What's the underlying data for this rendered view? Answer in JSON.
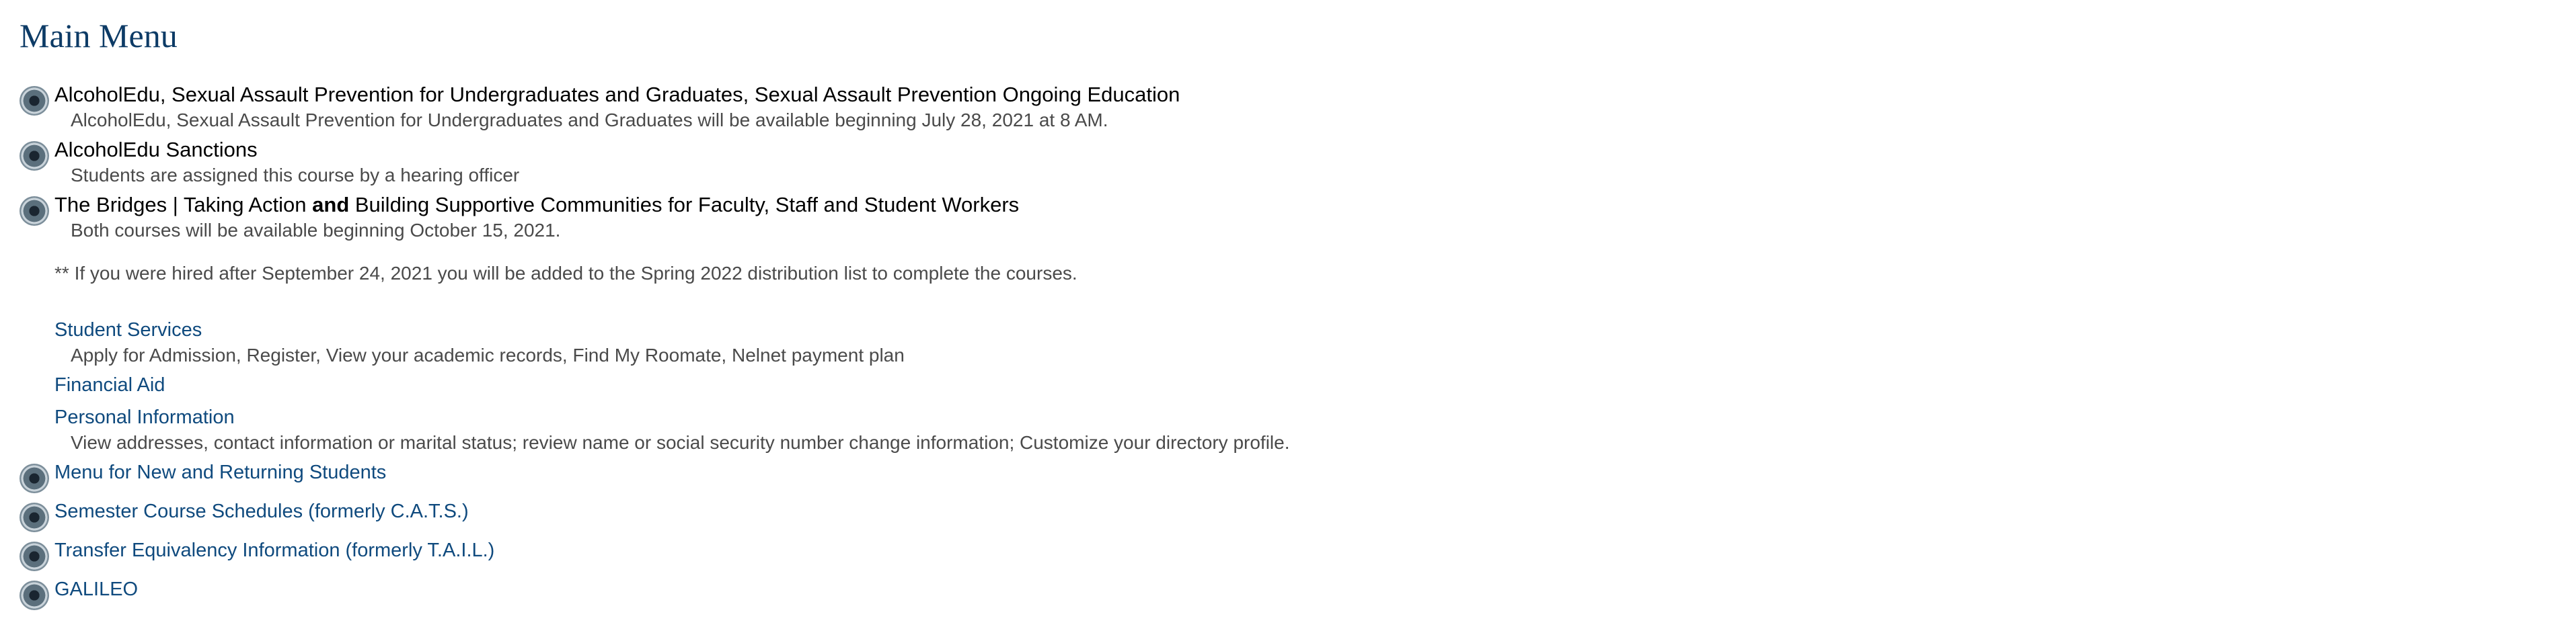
{
  "page_title": "Main Menu",
  "items": [
    {
      "title": "AlcoholEdu, Sexual Assault Prevention for Undergraduates and Graduates, Sexual Assault Prevention Ongoing Education",
      "desc": "AlcoholEdu, Sexual Assault Prevention for Undergraduates and Graduates will be available beginning July 28, 2021 at 8 AM."
    },
    {
      "title": "AlcoholEdu Sanctions",
      "desc": "Students are assigned this course by a hearing officer"
    },
    {
      "title_a": "The Bridges | Taking Action ",
      "title_bold": "and",
      "title_b": " Building Supportive Communities for Faculty, Staff and Student Workers",
      "desc": "Both courses will be available beginning October 15, 2021.",
      "note": "** If you were hired after September 24, 2021 you will be added to the Spring 2022 distribution list to complete the courses."
    }
  ],
  "links": [
    {
      "label": "Student Services",
      "desc": "Apply for Admission, Register, View your academic records, Find My Roomate, Nelnet payment plan"
    },
    {
      "label": "Financial Aid"
    },
    {
      "label": "Personal Information",
      "desc": "View addresses, contact information or marital status; review name or social security number change information; Customize your directory profile."
    }
  ],
  "bullet_links": [
    {
      "label": "Menu for New and Returning Students"
    },
    {
      "label": "Semester Course Schedules (formerly C.A.T.S.)"
    },
    {
      "label": "Transfer Equivalency Information (formerly T.A.I.L.)"
    },
    {
      "label": "GALILEO"
    }
  ]
}
